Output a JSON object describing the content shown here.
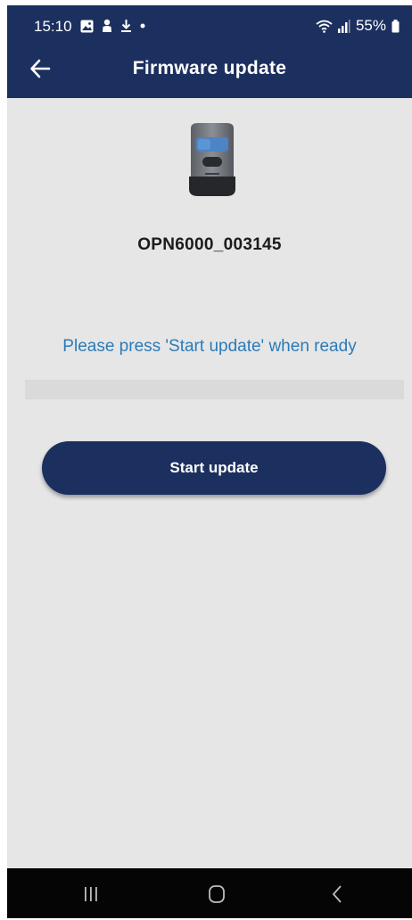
{
  "status_bar": {
    "time": "15:10",
    "left_icons": [
      "image-icon",
      "person-icon",
      "download-icon",
      "dot-icon"
    ],
    "right_icons": [
      "wifi-icon",
      "signal-icon",
      "battery-icon"
    ],
    "battery": "55%"
  },
  "header": {
    "title": "Firmware update",
    "back_icon": "arrow-left-icon",
    "background": "#1c305f"
  },
  "device": {
    "image_icon": "remote-device-icon",
    "name": "OPN6000_003145"
  },
  "instruction": "Please press 'Start update' when ready",
  "progress": {
    "value": 0
  },
  "start_button": {
    "label": "Start update"
  },
  "nav_bar": {
    "icons": [
      "recents-icon",
      "home-icon",
      "back-icon"
    ]
  },
  "colors": {
    "primary": "#1c305f",
    "accent_text": "#2c7bb7",
    "background": "#e6e6e6"
  }
}
